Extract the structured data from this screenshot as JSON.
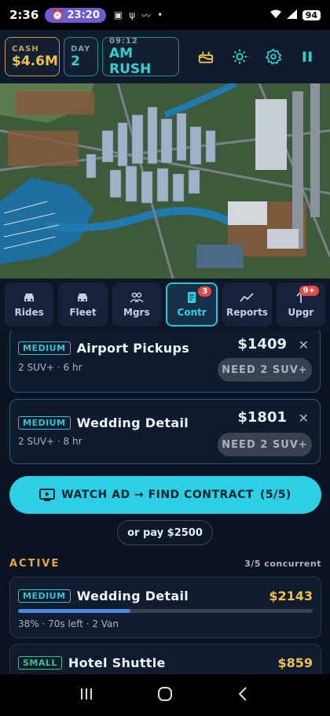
{
  "status_bar": {
    "time": "2:36",
    "alarm": "23:20",
    "battery": "94"
  },
  "hud": {
    "cash_label": "CASH",
    "cash_value": "$4.6M",
    "day_label": "DAY",
    "day_value": "2",
    "clock_label": "09:12",
    "clock_value": "AM RUSH",
    "icons": [
      "cake-icon",
      "sun-icon",
      "gear-icon",
      "pause-icon"
    ]
  },
  "tabs": [
    {
      "label": "Rides",
      "icon": "car-icon",
      "badge": ""
    },
    {
      "label": "Fleet",
      "icon": "car-icon",
      "badge": ""
    },
    {
      "label": "Mgrs",
      "icon": "people-icon",
      "badge": ""
    },
    {
      "label": "Contr",
      "icon": "document-icon",
      "badge": "3",
      "active": true
    },
    {
      "label": "Reports",
      "icon": "chart-icon",
      "badge": ""
    },
    {
      "label": "Upgr",
      "icon": "upgrade-icon",
      "badge": "9+"
    }
  ],
  "contracts": [
    {
      "tier": "MEDIUM",
      "title": "Airport Pickups",
      "price": "$1409",
      "details": "2 SUV+ · 6 hr",
      "need": "NEED 2 SUV+"
    },
    {
      "tier": "MEDIUM",
      "title": "Wedding Detail",
      "price": "$1801",
      "details": "2 SUV+ · 8 hr",
      "need": "NEED 2 SUV+"
    }
  ],
  "watch_ad": {
    "label": "WATCH AD → FIND CONTRACT",
    "count": "(5/5)"
  },
  "pay": {
    "label": "or pay $2500"
  },
  "active": {
    "title": "ACTIVE",
    "meta": "3/5 concurrent",
    "items": [
      {
        "tier": "MEDIUM",
        "title": "Wedding Detail",
        "price": "$2143",
        "progress": 0.38,
        "details": "38% · 70s left · 2 Van"
      },
      {
        "tier": "SMALL",
        "title": "Hotel Shuttle",
        "price": "$859"
      }
    ]
  },
  "colors": {
    "accent": "#2bd0e6",
    "gold": "#f2c04a",
    "active_label": "#e3a93a",
    "progress": "#4a88e6"
  }
}
